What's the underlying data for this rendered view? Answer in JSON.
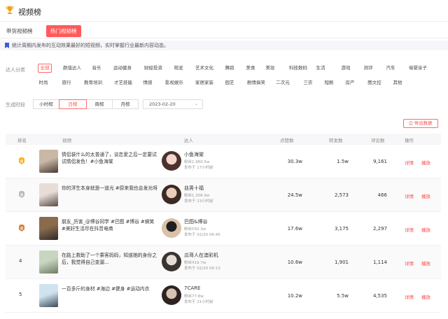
{
  "page": {
    "title": "视频榜"
  },
  "tabs": [
    "带货视频榜",
    "热门视频榜"
  ],
  "notice": "统计周期内发布的互动效果最好的短视频，实时掌握行业最新内容动态。",
  "filters": {
    "category_label": "达人分类",
    "categories_row1": [
      "全部",
      "颜值达人",
      "音乐",
      "运动健身",
      "财经投资",
      "萌宠",
      "艺术文化",
      "舞蹈",
      "美食",
      "美妆",
      "科技数码",
      "生活",
      "游戏",
      "测评",
      "汽车",
      "母婴亲子"
    ],
    "categories_row2": [
      "时尚",
      "旅行",
      "教育培训",
      "才艺技能",
      "情感",
      "影视娱乐",
      "家居家装",
      "园艺",
      "剧情搞笑",
      "二次元",
      "三农",
      "短剧",
      "房产",
      "图文控",
      "其他"
    ],
    "time_label": "生成时段",
    "periods": [
      "小时榜",
      "日榜",
      "周榜",
      "月榜"
    ],
    "date": "2023-02-20"
  },
  "export_label": "导出数据",
  "columns": [
    "排名",
    "视频",
    "达人",
    "点赞数",
    "转发数",
    "评论数",
    "操作"
  ],
  "rows": [
    {
      "rank": "1",
      "title": "情侣装什么的太普通了，谈恋爱之后一定要试试情侣发色！#小鱼海棠",
      "creator": "小鱼海棠",
      "fans": "粉丝1,960.5w",
      "posted": "发布于 17小时前",
      "likes": "30.3w",
      "shares": "1.5w",
      "comments": "9,161"
    },
    {
      "rank": "2",
      "title": "你的浮生本身就是一道光 #原来我也会发光呀",
      "creator": "韭男十福",
      "fans": "粉丝1,306.9w",
      "posted": "发布于 23小时前",
      "likes": "24.5w",
      "shares": "2,573",
      "comments": "466"
    },
    {
      "rank": "3",
      "title": "朋友_厉害_@博谷同学 #巴图 #博谷 #搞笑 #美好生活尽在抖音电商",
      "creator": "巴图&博谷",
      "fans": "粉丝550.3w",
      "posted": "发布于 02/20 06:45",
      "likes": "17.6w",
      "shares": "3,175",
      "comments": "2,297"
    },
    {
      "rank": "4",
      "title": "在路上救助了一个乘客妈妈，知道她的身份之后，我觉得自己变漏...",
      "creator": "瓜哥人在澳彩机",
      "fans": "粉丝419.7w",
      "posted": "发布于 02/20 09:13",
      "likes": "10.6w",
      "shares": "1,901",
      "comments": "1,114"
    },
    {
      "rank": "5",
      "title": "一百多斤的身材 #海边 #健身 #运动内衣",
      "creator": "7CARE",
      "fans": "粉丝77.8w",
      "posted": "发布于 21小时前",
      "likes": "10.2w",
      "shares": "5.5w",
      "comments": "4,535"
    }
  ],
  "actions": {
    "detail": "详情",
    "play": "播放"
  },
  "colors": {
    "accent": "#ff4d4f",
    "gold": "#f5b21b",
    "silver": "#b9b9c0",
    "bronze": "#d9823b"
  }
}
